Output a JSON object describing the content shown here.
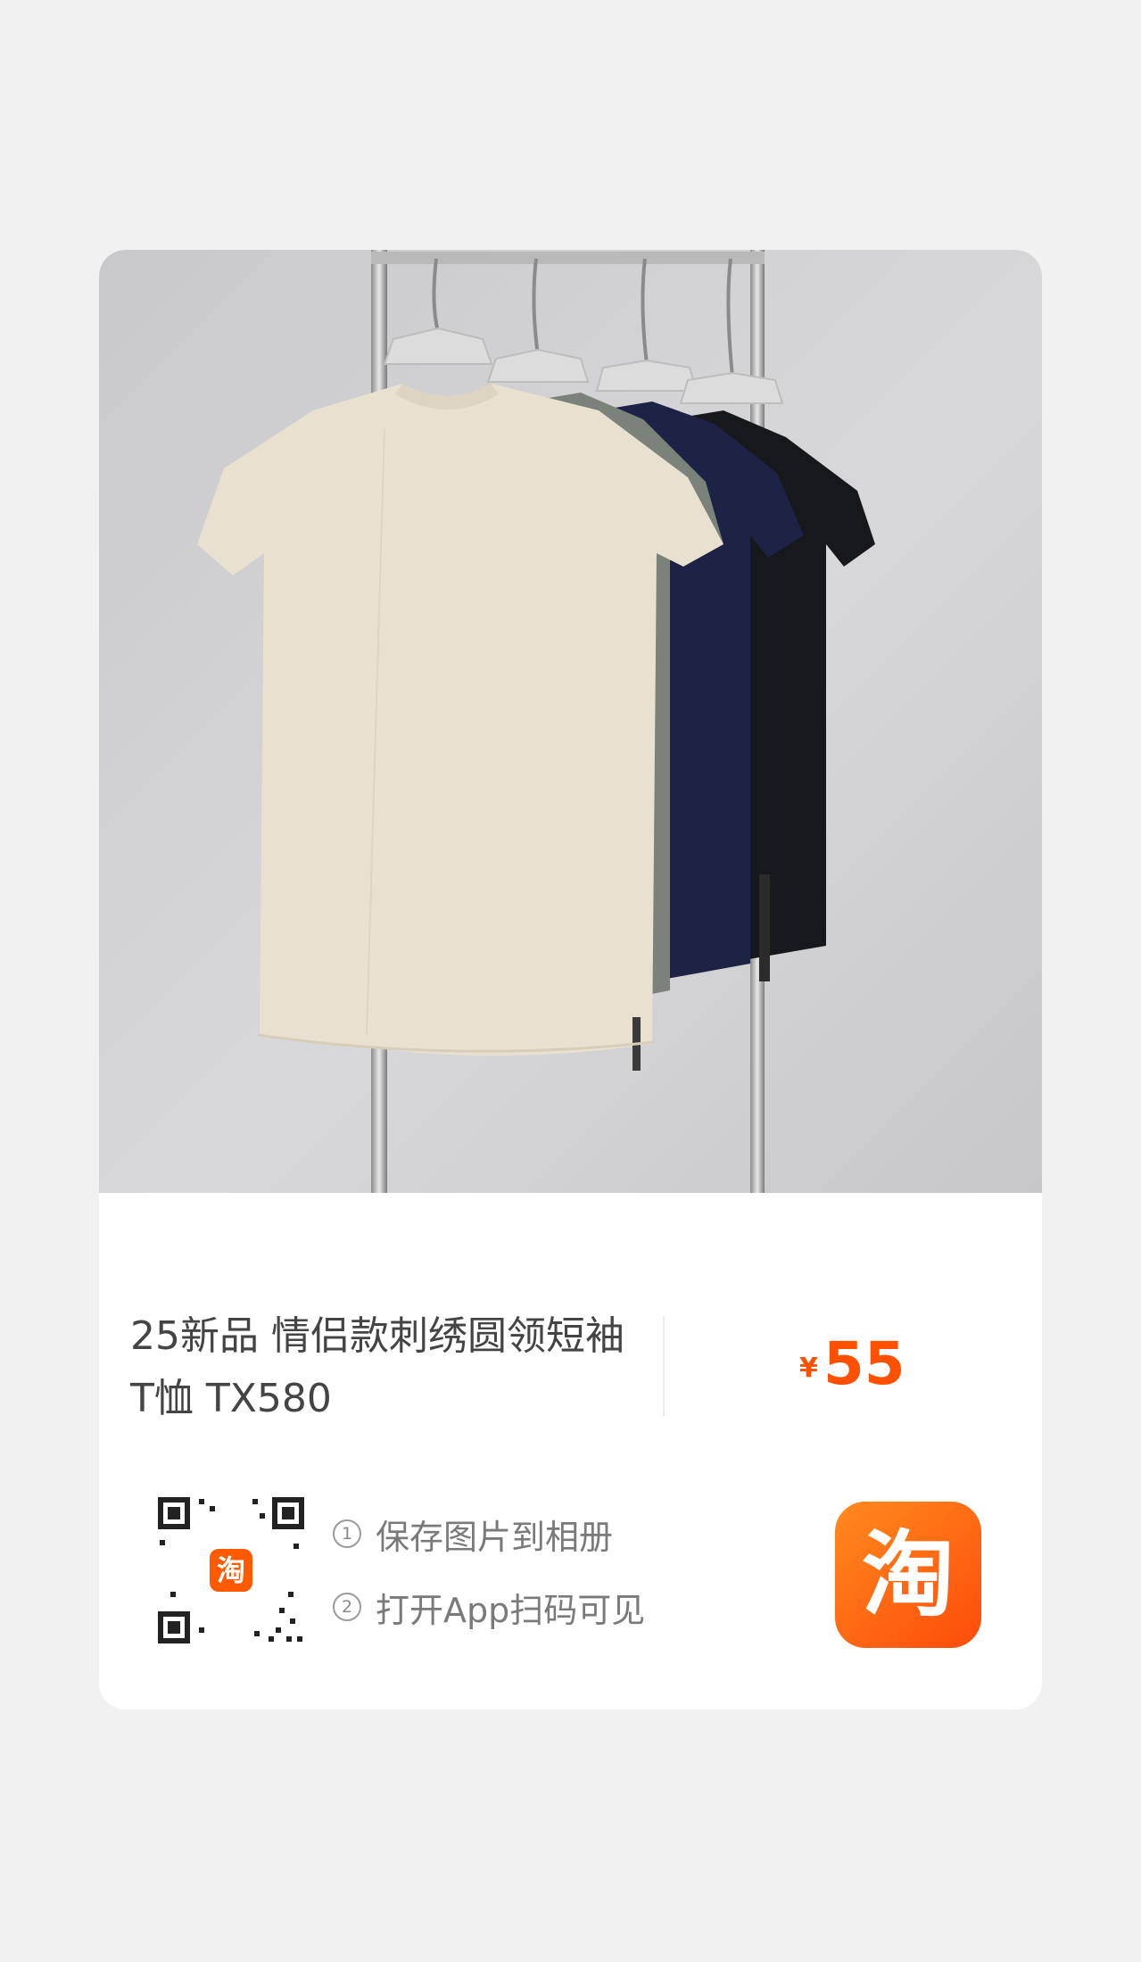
{
  "product": {
    "title": "25新品 情侣款刺绣圆领短袖T恤 TX580",
    "price_currency": "¥",
    "price_value": "55"
  },
  "image": {
    "subject": "t-shirts on clothing rack",
    "colors": [
      "#e9e1d0",
      "#7b8279",
      "#1e2345",
      "#17181b"
    ]
  },
  "qr": {
    "badge_text": "淘"
  },
  "steps": [
    {
      "number": "1",
      "text": "保存图片到相册"
    },
    {
      "number": "2",
      "text": "打开App扫码可见"
    }
  ],
  "app_logo": {
    "text": "淘"
  },
  "colors": {
    "accent": "#ff5000",
    "logo": "#ff5a00"
  }
}
